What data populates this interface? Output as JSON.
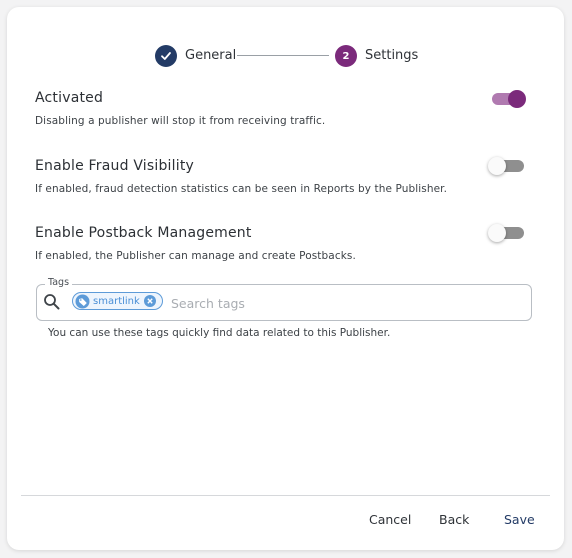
{
  "stepper": {
    "steps": [
      {
        "label": "General",
        "state": "completed"
      },
      {
        "label": "Settings",
        "number": "2",
        "state": "active"
      }
    ]
  },
  "settings": [
    {
      "title": "Activated",
      "description": "Disabling a publisher will stop it from receiving traffic.",
      "enabled": true
    },
    {
      "title": "Enable Fraud Visibility",
      "description": "If enabled, fraud detection statistics can be seen in Reports by the Publisher.",
      "enabled": false
    },
    {
      "title": "Enable Postback Management",
      "description": "If enabled, the Publisher can manage and create Postbacks.",
      "enabled": false
    }
  ],
  "tags": {
    "legend": "Tags",
    "chips": [
      {
        "label": "smartlink",
        "icon": "tag-icon"
      }
    ],
    "placeholder": "Search tags",
    "value": "",
    "help": "You can use these tags quickly find data related to this Publisher."
  },
  "footer": {
    "cancel_label": "Cancel",
    "back_label": "Back",
    "save_label": "Save"
  },
  "colors": {
    "primary_navy": "#233b66",
    "accent_purple": "#7b2a7b",
    "chip_blue": "#4a8fd6"
  }
}
